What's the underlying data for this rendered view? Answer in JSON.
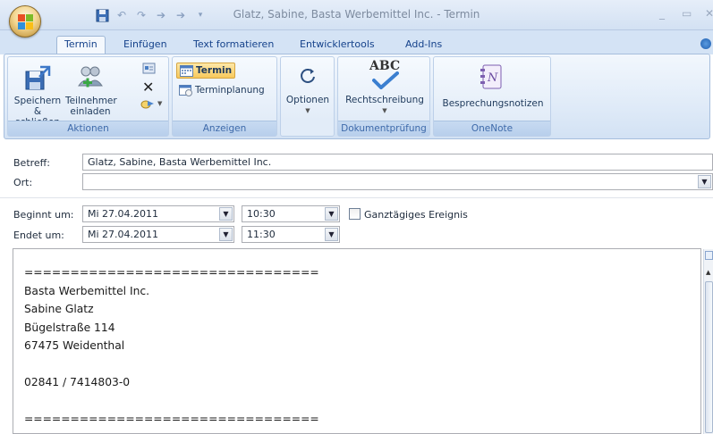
{
  "window": {
    "title": "Glatz, Sabine, Basta Werbemittel Inc. - Termin"
  },
  "tabs": [
    {
      "label": "Termin",
      "active": true
    },
    {
      "label": "Einfügen",
      "active": false
    },
    {
      "label": "Text formatieren",
      "active": false
    },
    {
      "label": "Entwicklertools",
      "active": false
    },
    {
      "label": "Add-Ins",
      "active": false
    }
  ],
  "ribbon": {
    "aktionen": {
      "label": "Aktionen",
      "save_line1": "Speichern",
      "save_line2": "& schließen",
      "invite_line1": "Teilnehmer",
      "invite_line2": "einladen"
    },
    "anzeigen": {
      "label": "Anzeigen",
      "termin": "Termin",
      "terminplanung": "Terminplanung"
    },
    "optionen": {
      "label": "Optionen"
    },
    "dokumentpruefung": {
      "label": "Dokumentprüfung",
      "rechtschreibung": "Rechtschreibung",
      "abc": "ABC"
    },
    "onenote": {
      "label": "OneNote",
      "besprechungsnotizen": "Besprechungsnotizen"
    }
  },
  "form": {
    "betreff_label": "Betreff:",
    "betreff_value": "Glatz, Sabine, Basta Werbemittel Inc.",
    "ort_label": "Ort:",
    "ort_value": "",
    "beginnt_label": "Beginnt um:",
    "beginnt_date": "Mi 27.04.2011",
    "beginnt_time": "10:30",
    "endet_label": "Endet um:",
    "endet_date": "Mi 27.04.2011",
    "endet_time": "11:30",
    "ganztaegig_label": "Ganztägiges Ereignis",
    "ganztaegig_checked": false
  },
  "body": {
    "text": "================================\nBasta Werbemittel Inc.\nSabine Glatz\nBügelstraße 114\n67475 Weidenthal\n\n02841 / 7414803-0\n\n================================"
  },
  "colors": {
    "accent": "#15428b",
    "ribbon_bg": "#dbe7f6",
    "group_label": "#3e6aaa"
  }
}
